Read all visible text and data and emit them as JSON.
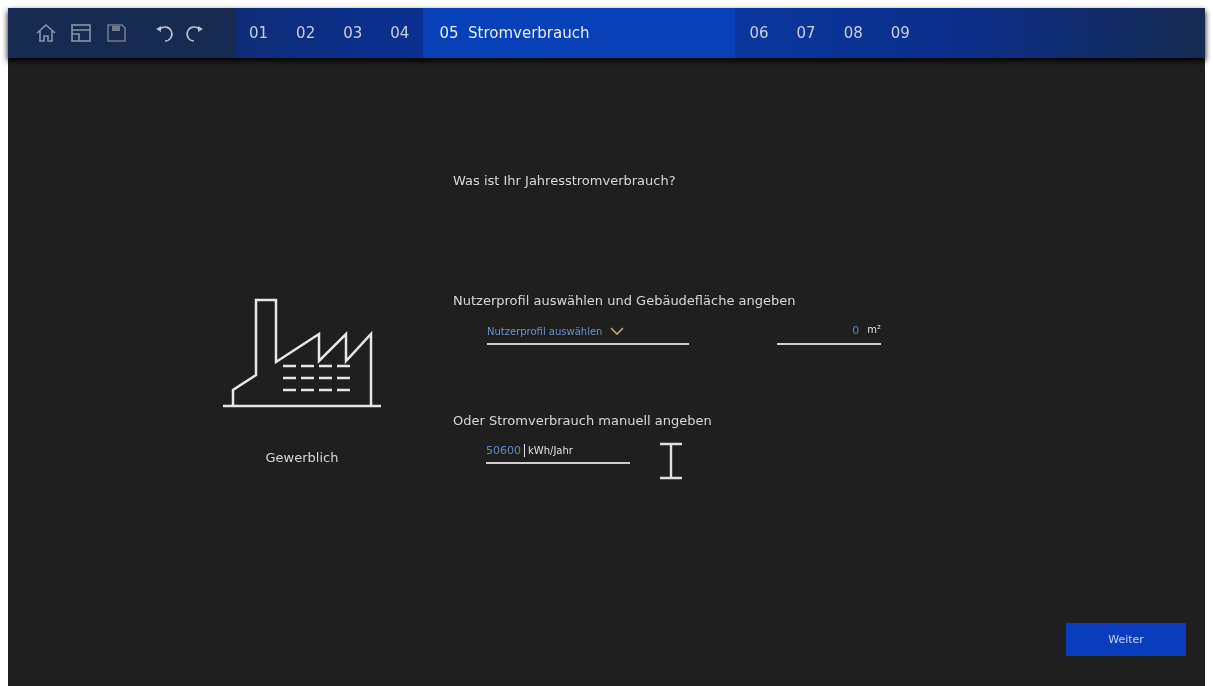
{
  "toolbar": {
    "buttons": [
      {
        "kind": "home"
      },
      {
        "kind": "folder"
      },
      {
        "kind": "save"
      },
      {
        "kind": "undo"
      },
      {
        "kind": "redo"
      }
    ]
  },
  "steps": [
    {
      "number": "01",
      "selected": false
    },
    {
      "number": "02",
      "selected": false
    },
    {
      "number": "03",
      "selected": false
    },
    {
      "number": "04",
      "selected": false
    },
    {
      "number": "05",
      "label": "Stromverbrauch",
      "selected": true
    },
    {
      "number": "06",
      "selected": false
    },
    {
      "number": "07",
      "selected": false
    },
    {
      "number": "08",
      "selected": false
    },
    {
      "number": "09",
      "selected": false
    }
  ],
  "question": "Was ist Ihr Jahresstromverbrauch?",
  "category": {
    "label": "Gewerblich"
  },
  "profile_section": {
    "label": "Nutzerprofil auswählen und Gebäudefläche angeben",
    "dropdown": {
      "placeholder": "Nutzerprofil auswählen"
    },
    "area": {
      "value": "0",
      "unit": "m²"
    }
  },
  "manual_section": {
    "label": "Oder Stromverbrauch manuell angeben",
    "consumption": {
      "value": "50600",
      "unit": "kWh/Jahr"
    }
  },
  "next_button": "Weiter"
}
